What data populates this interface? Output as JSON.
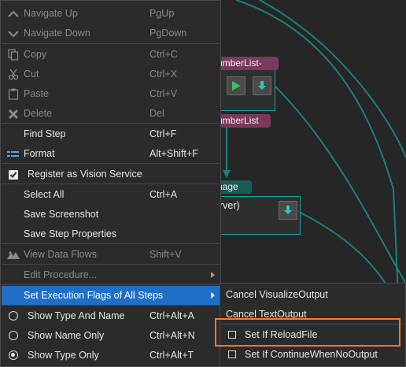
{
  "canvas": {
    "tags": {
      "number_list_top": "umberList-",
      "number_list_bottom": "umberList",
      "image": "nage"
    },
    "server_node_text": "erver)"
  },
  "menu": {
    "items": [
      {
        "label": "Navigate Up",
        "shortcut": "PgUp",
        "icon": "chevron-up-icon"
      },
      {
        "label": "Navigate Down",
        "shortcut": "PgDown",
        "icon": "chevron-down-icon"
      },
      {
        "label": "Copy",
        "shortcut": "Ctrl+C",
        "icon": "copy-icon"
      },
      {
        "label": "Cut",
        "shortcut": "Ctrl+X",
        "icon": "scissors-icon"
      },
      {
        "label": "Paste",
        "shortcut": "Ctrl+V",
        "icon": "clipboard-icon"
      },
      {
        "label": "Delete",
        "shortcut": "Del",
        "icon": "delete-icon"
      },
      {
        "label": "Find Step",
        "shortcut": "Ctrl+F"
      },
      {
        "label": "Format",
        "shortcut": "Alt+Shift+F",
        "icon": "format-icon"
      },
      {
        "label": "Register as Vision Service",
        "checked": true
      },
      {
        "label": "Select All",
        "shortcut": "Ctrl+A"
      },
      {
        "label": "Save Screenshot"
      },
      {
        "label": "Save Step Properties"
      },
      {
        "label": "View Data Flows",
        "shortcut": "Shift+V",
        "icon": "mountain-icon"
      },
      {
        "label": "Edit Procedure..."
      },
      {
        "label": "Set Execution Flags of All Steps"
      },
      {
        "label": "Show Type And Name",
        "shortcut": "Ctrl+Alt+A",
        "selected": false
      },
      {
        "label": "Show Name Only",
        "shortcut": "Ctrl+Alt+N",
        "selected": false
      },
      {
        "label": "Show Type Only",
        "shortcut": "Ctrl+Alt+T",
        "selected": true
      }
    ]
  },
  "submenu": {
    "items": [
      {
        "label": "Cancel VisualizeOutput"
      },
      {
        "label": "Cancel TextOutput"
      },
      {
        "label": "Set If ReloadFile",
        "checked": false
      },
      {
        "label": "Set If ContinueWhenNoOutput",
        "checked": false
      }
    ]
  },
  "colors": {
    "menu_bg": "#2b2b2b",
    "highlight": "#1f6fc7",
    "node_border": "#14a8a8",
    "annotation": "#ff7a1a"
  }
}
